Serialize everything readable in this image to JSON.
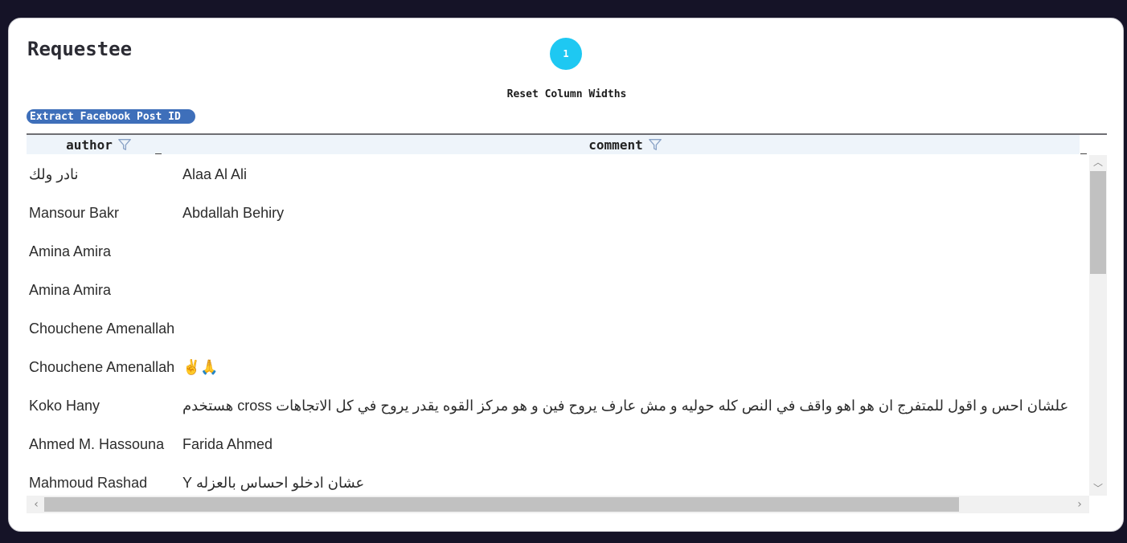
{
  "panel": {
    "title": "Requestee",
    "badge": "1",
    "reset_label": "Reset Column Widths",
    "extract_label": "Extract Facebook Post ID"
  },
  "table": {
    "columns": [
      "author",
      "comment"
    ],
    "rows": [
      {
        "author": "نادر ولك",
        "comment": "Alaa Al Ali",
        "rtl_author": true,
        "rtl_comment": false
      },
      {
        "author": "Mansour Bakr",
        "comment": "Abdallah Behiry",
        "rtl_author": false,
        "rtl_comment": false
      },
      {
        "author": "Amina Amira",
        "comment": "",
        "rtl_author": false,
        "rtl_comment": false
      },
      {
        "author": "Amina Amira",
        "comment": "",
        "rtl_author": false,
        "rtl_comment": false
      },
      {
        "author": "Chouchene Amenallah",
        "comment": "",
        "rtl_author": false,
        "rtl_comment": false
      },
      {
        "author": "Chouchene Amenallah",
        "comment": "✌️🙏",
        "rtl_author": false,
        "rtl_comment": false
      },
      {
        "author": "Koko Hany",
        "comment": "علشان احس و اقول للمتفرج ان هو اهو واقف في النص كله حوليه و مش عارف يروح فين و هو مركز القوه يقدر يروح في كل الاتجاهات cross هستخدم",
        "rtl_author": false,
        "rtl_comment": true
      },
      {
        "author": "Ahmed M. Hassouna",
        "comment": "Farida Ahmed",
        "rtl_author": false,
        "rtl_comment": false
      },
      {
        "author": "Mahmoud Rashad",
        "comment": "عشان ادخلو احساس بالعزله Y",
        "rtl_author": false,
        "rtl_comment": true
      }
    ]
  },
  "colors": {
    "page_bg": "#151327",
    "badge": "#1ec8f2",
    "extract_button": "#3e6fba",
    "header_bg": "#eef4fa"
  },
  "icons": {
    "filter": "funnel-icon",
    "scroll_up": "chevron-up-icon",
    "scroll_down": "chevron-down-icon",
    "scroll_left": "chevron-left-icon",
    "scroll_right": "chevron-right-icon"
  }
}
